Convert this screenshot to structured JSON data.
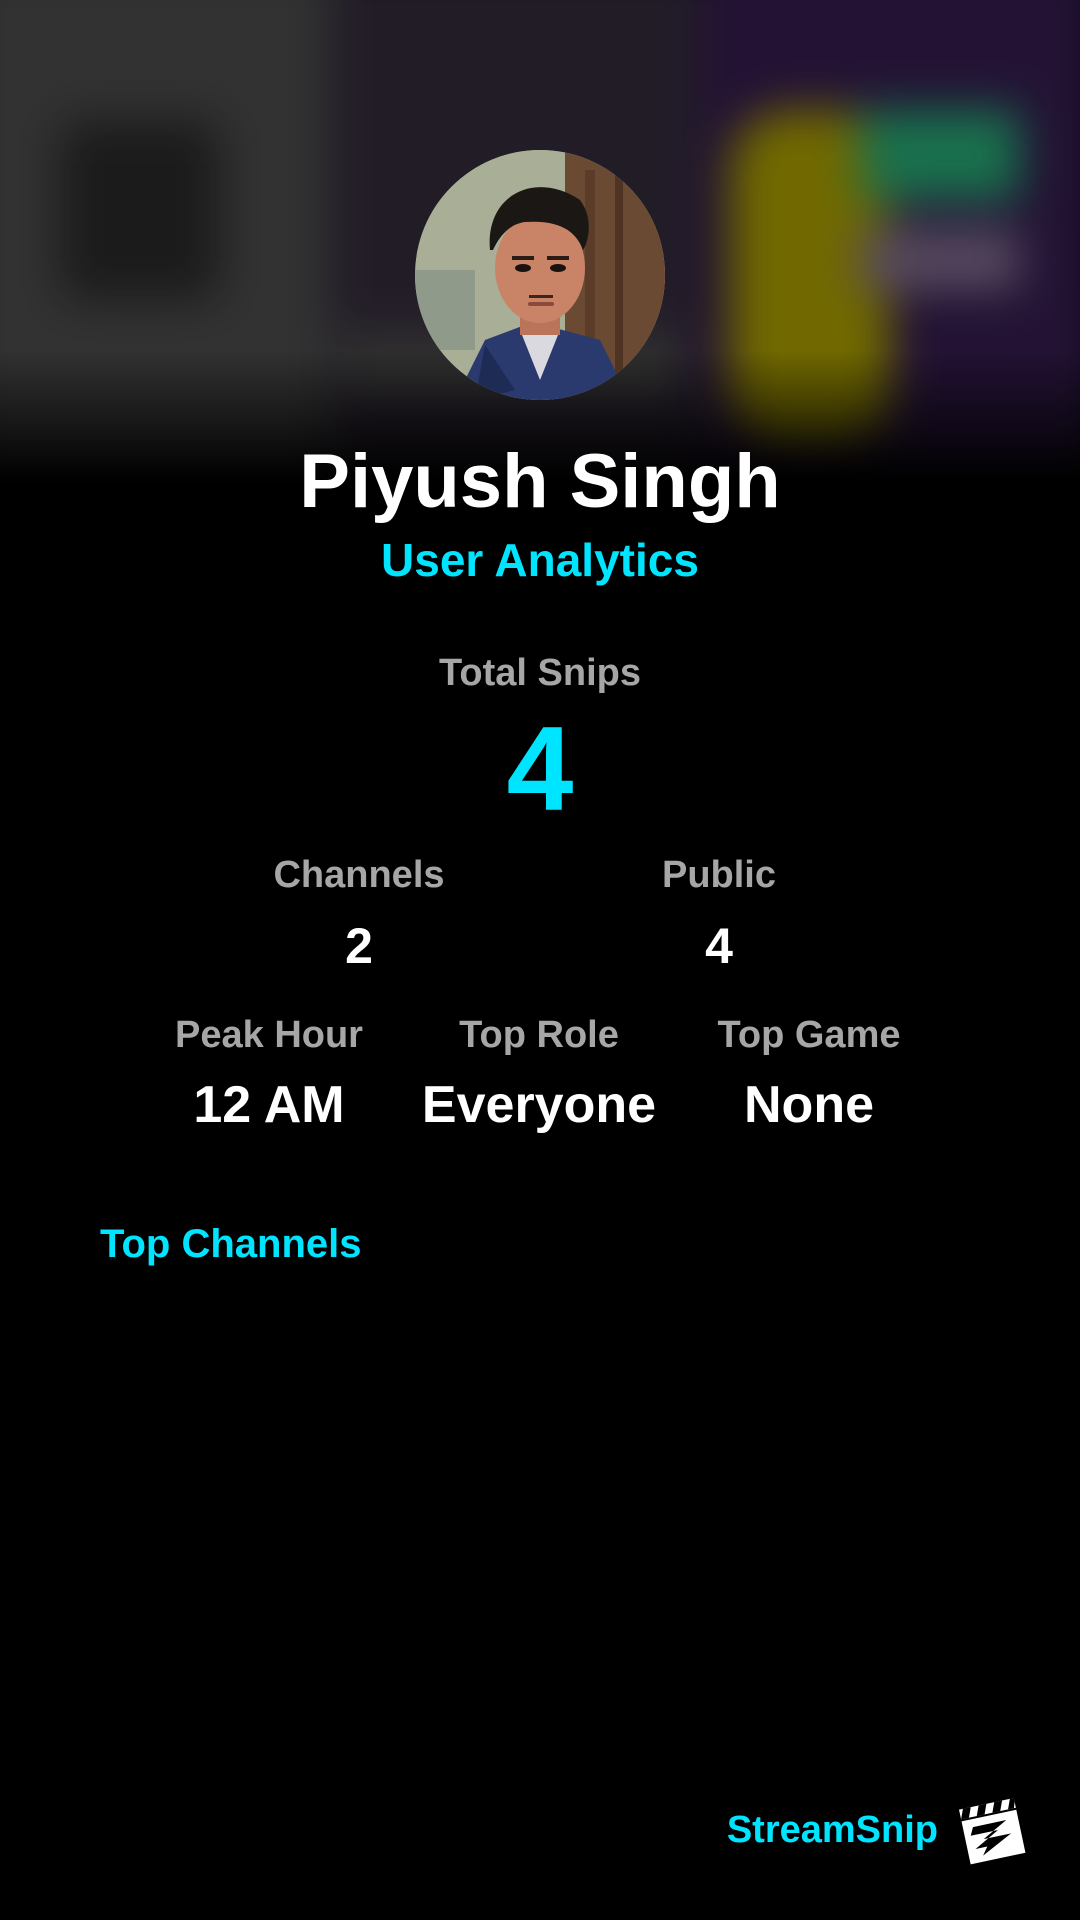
{
  "profile": {
    "name": "Piyush Singh",
    "subtitle": "User Analytics"
  },
  "stats": {
    "total_snips": {
      "label": "Total Snips",
      "value": "4"
    },
    "channels": {
      "label": "Channels",
      "value": "2"
    },
    "public": {
      "label": "Public",
      "value": "4"
    },
    "peak_hour": {
      "label": "Peak Hour",
      "value": "12 AM"
    },
    "top_role": {
      "label": "Top Role",
      "value": "Everyone"
    },
    "top_game": {
      "label": "Top Game",
      "value": "None"
    }
  },
  "top_channels": {
    "title": "Top Channels",
    "items": []
  },
  "brand": {
    "name": "StreamSnip",
    "logo_icon": "clapperboard-icon"
  },
  "colors": {
    "accent": "#00e5ff",
    "label": "#a6a6a6",
    "background": "#000000"
  }
}
